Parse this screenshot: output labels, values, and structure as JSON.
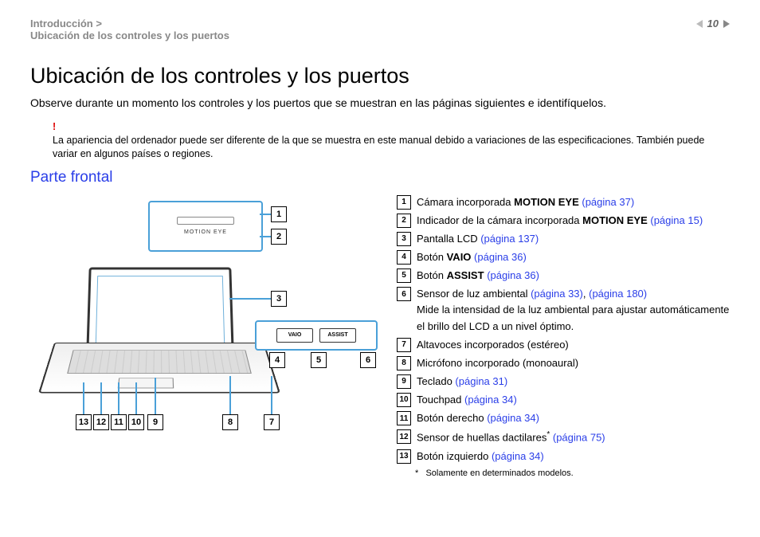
{
  "breadcrumb": {
    "line1": "Introducción >",
    "line2": "Ubicación de los controles y los puertos"
  },
  "page_number": "10",
  "h1": "Ubicación de los controles y los puertos",
  "intro": "Observe durante un momento los controles y los puertos que se muestran en las páginas siguientes e identifíquelos.",
  "warning_mark": "!",
  "warning": "La apariencia del ordenador puede ser diferente de la que se muestra en este manual debido a variaciones de las especificaciones. También puede variar en algunos países o regiones.",
  "h2": "Parte frontal",
  "me_label": "MOTION EYE",
  "btn_vaio": "VAIO",
  "btn_assist": "ASSIST",
  "callouts": {
    "1": "1",
    "2": "2",
    "3": "3",
    "4": "4",
    "5": "5",
    "6": "6",
    "7": "7",
    "8": "8",
    "9": "9",
    "10": "10",
    "11": "11",
    "12": "12",
    "13": "13"
  },
  "items": [
    {
      "n": "1",
      "pre": "Cámara incorporada ",
      "bold": "MOTION EYE",
      "post": " ",
      "pg": "(página 37)"
    },
    {
      "n": "2",
      "pre": "Indicador de la cámara incorporada ",
      "bold": "MOTION EYE",
      "post": " ",
      "pg": "(página 15)"
    },
    {
      "n": "3",
      "pre": "Pantalla LCD ",
      "bold": "",
      "post": "",
      "pg": "(página 137)"
    },
    {
      "n": "4",
      "pre": "Botón ",
      "bold": "VAIO",
      "post": " ",
      "pg": "(página 36)"
    },
    {
      "n": "5",
      "pre": "Botón ",
      "bold": "ASSIST",
      "post": " ",
      "pg": "(página 36)"
    },
    {
      "n": "6",
      "pre": "Sensor de luz ambiental ",
      "bold": "",
      "post": "",
      "pg": "(página 33)",
      "pg2": "(página 180)",
      "sub": "Mide la intensidad de la luz ambiental para ajustar automáticamente el brillo del LCD a un nivel óptimo."
    },
    {
      "n": "7",
      "pre": "Altavoces incorporados (estéreo)",
      "bold": "",
      "post": "",
      "pg": ""
    },
    {
      "n": "8",
      "pre": "Micrófono incorporado (monoaural)",
      "bold": "",
      "post": "",
      "pg": ""
    },
    {
      "n": "9",
      "pre": "Teclado ",
      "bold": "",
      "post": "",
      "pg": "(página 31)"
    },
    {
      "n": "10",
      "pre": "Touchpad ",
      "bold": "",
      "post": "",
      "pg": "(página 34)"
    },
    {
      "n": "11",
      "pre": "Botón derecho ",
      "bold": "",
      "post": "",
      "pg": "(página 34)"
    },
    {
      "n": "12",
      "pre": "Sensor de huellas dactilares",
      "bold": "",
      "post": "",
      "pg": "(página 75)",
      "ast": "*"
    },
    {
      "n": "13",
      "pre": "Botón izquierdo ",
      "bold": "",
      "post": "",
      "pg": "(página 34)"
    }
  ],
  "footnote_mark": "*",
  "footnote": "Solamente en determinados modelos.",
  "comma": ", "
}
